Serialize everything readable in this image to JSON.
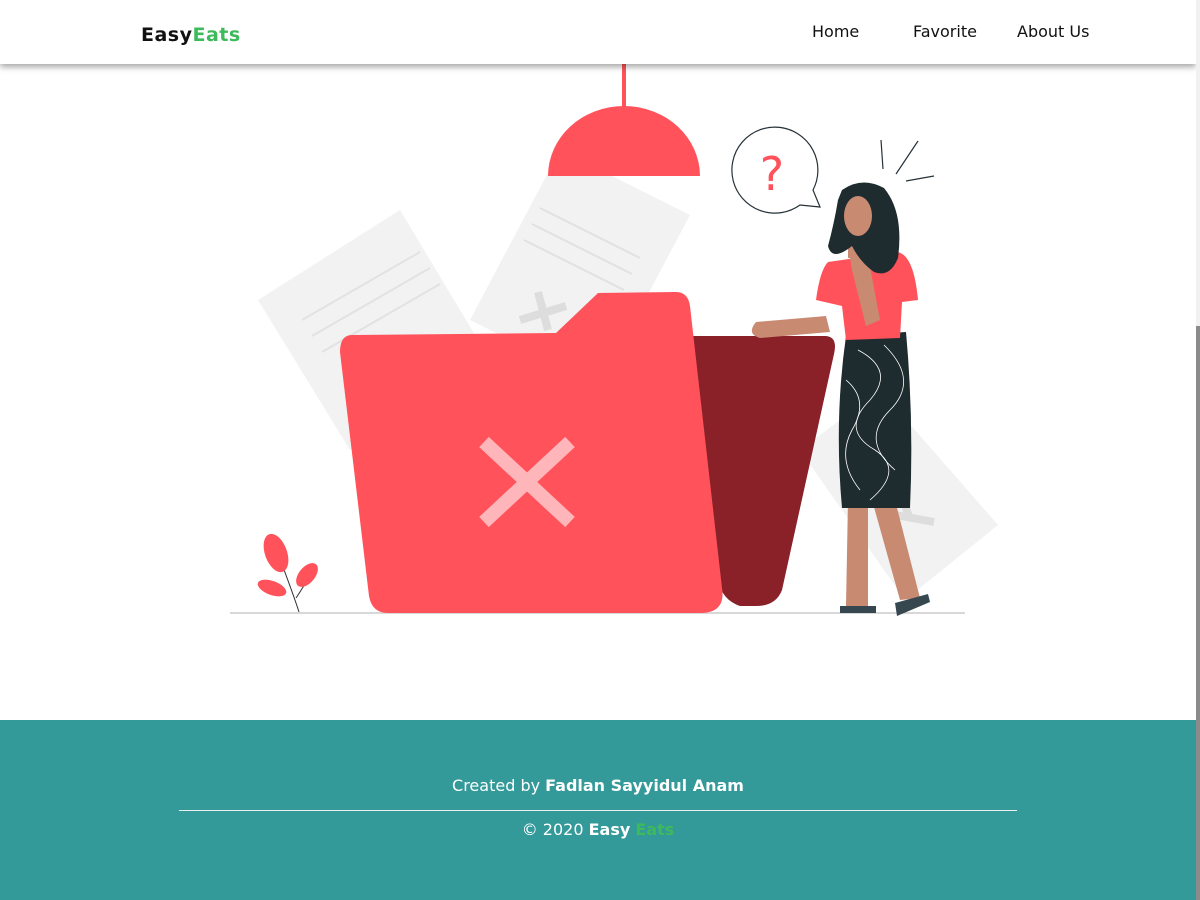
{
  "header": {
    "logo_part1": "Easy",
    "logo_part2": "Eats",
    "nav": {
      "home": "Home",
      "favorite": "Favorite",
      "about": "About Us"
    }
  },
  "main": {
    "illustration": "not-found-folder-illustration",
    "question_mark": "?"
  },
  "footer": {
    "created_by_prefix": "Created by",
    "author": "Fadlan Sayyidul Anam",
    "copyright_prefix": "© 2020",
    "brand_part1": "Easy",
    "brand_part2": "Eats"
  },
  "colors": {
    "accent": "#3dba5b",
    "illustration_red": "#ff525b",
    "folder_back": "#8a2129",
    "footer_bg": "#339999"
  }
}
